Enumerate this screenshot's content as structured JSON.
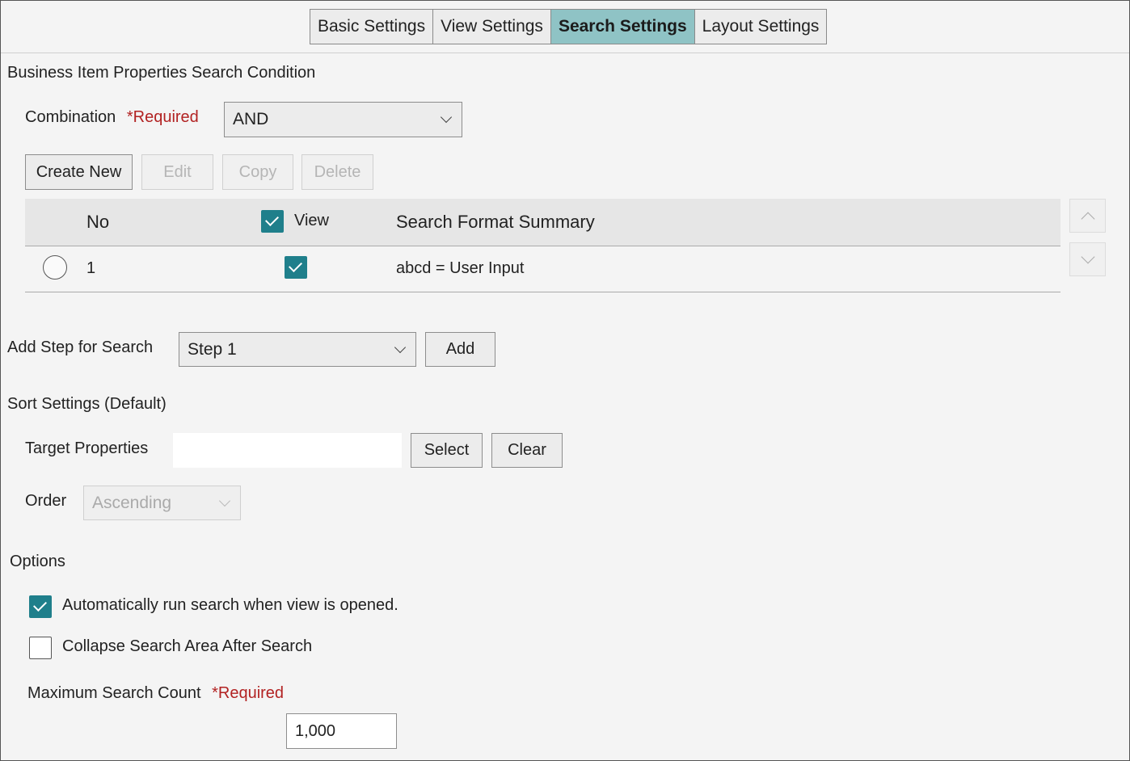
{
  "tabs": [
    "Basic Settings",
    "View Settings",
    "Search Settings",
    "Layout Settings"
  ],
  "active_tab": "Search Settings",
  "business_item": {
    "section_title": "Business Item Properties Search Condition",
    "combination_label": "Combination",
    "required_label": "*Required",
    "combination_value": "AND",
    "buttons": {
      "create_new": "Create New",
      "edit": "Edit",
      "copy": "Copy",
      "delete": "Delete"
    },
    "table": {
      "headers": {
        "no": "No",
        "view": "View",
        "summary": "Search Format Summary"
      },
      "rows": [
        {
          "no": "1",
          "view": true,
          "summary": "abcd = User Input"
        }
      ]
    }
  },
  "add_step": {
    "label": "Add Step for Search",
    "value": "Step 1",
    "button": "Add"
  },
  "sort": {
    "section_title": "Sort Settings (Default)",
    "target_label": "Target Properties",
    "target_value": "",
    "select_button": "Select",
    "clear_button": "Clear",
    "order_label": "Order",
    "order_value": "Ascending"
  },
  "options": {
    "section_title": "Options",
    "auto_run_label": "Automatically run search when view is opened.",
    "auto_run_checked": true,
    "collapse_label": "Collapse Search Area After Search",
    "collapse_checked": false,
    "max_count_label": "Maximum Search Count",
    "required_label": "*Required",
    "max_count_value": "1,000"
  },
  "colors": {
    "accent": "#1f7f8b",
    "active_tab": "#8fc3c5",
    "required": "#b22222"
  }
}
